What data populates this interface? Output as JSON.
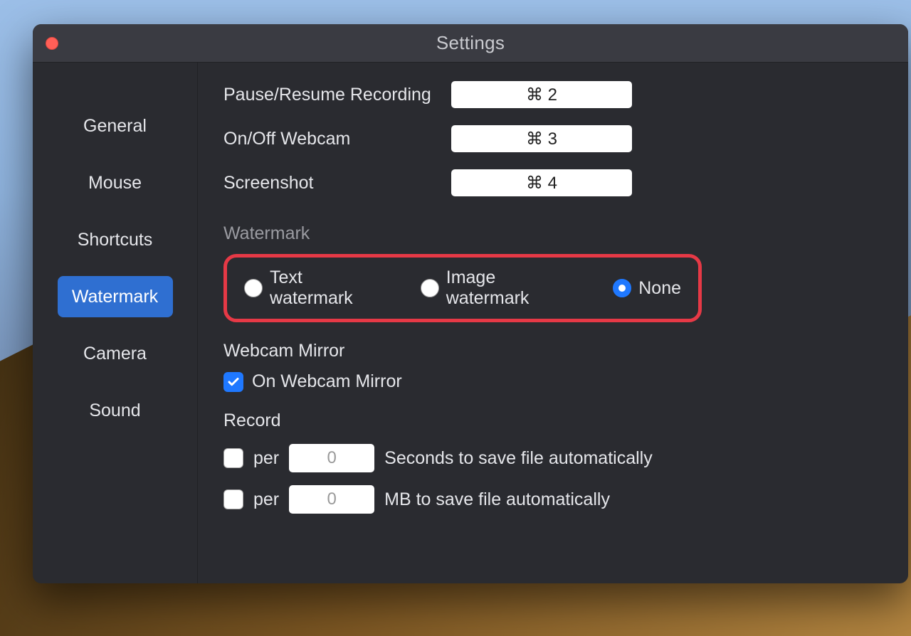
{
  "window": {
    "title": "Settings"
  },
  "sidebar": {
    "items": [
      {
        "label": "General"
      },
      {
        "label": "Mouse"
      },
      {
        "label": "Shortcuts"
      },
      {
        "label": "Watermark"
      },
      {
        "label": "Camera"
      },
      {
        "label": "Sound"
      }
    ],
    "active_index": 3
  },
  "shortcuts": {
    "rows": [
      {
        "label": "Pause/Resume Recording",
        "value": "⌘ 2"
      },
      {
        "label": "On/Off Webcam",
        "value": "⌘ 3"
      },
      {
        "label": "Screenshot",
        "value": "⌘ 4"
      }
    ]
  },
  "watermark": {
    "header": "Watermark",
    "options": [
      {
        "label": "Text watermark",
        "selected": false
      },
      {
        "label": "Image watermark",
        "selected": false
      },
      {
        "label": "None",
        "selected": true
      }
    ]
  },
  "webcam_mirror": {
    "header": "Webcam Mirror",
    "checkbox_label": "On Webcam Mirror",
    "checked": true
  },
  "record": {
    "header": "Record",
    "rows": [
      {
        "checked": false,
        "per_label": "per",
        "value": "0",
        "suffix": "Seconds to save file automatically"
      },
      {
        "checked": false,
        "per_label": "per",
        "value": "0",
        "suffix": "MB to save file automatically"
      }
    ]
  }
}
